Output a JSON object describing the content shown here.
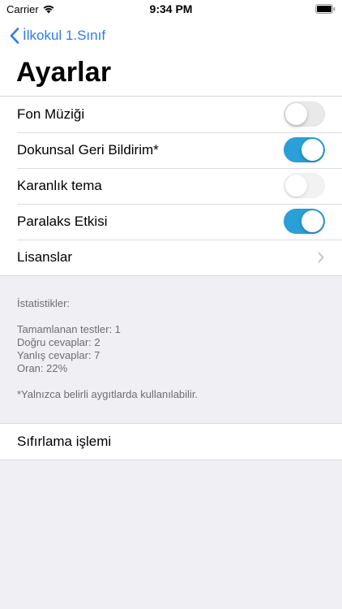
{
  "status_bar": {
    "carrier": "Carrier",
    "time": "9:34 PM"
  },
  "nav": {
    "back_label": "İlkokul 1.Sınıf",
    "title": "Ayarlar"
  },
  "settings": {
    "items": [
      {
        "label": "Fon Müziği",
        "control": "toggle",
        "on": false
      },
      {
        "label": "Dokunsal Geri Bildirim*",
        "control": "toggle",
        "on": true
      },
      {
        "label": "Karanlık tema",
        "control": "toggle",
        "on": false,
        "disabled": true
      },
      {
        "label": "Paralaks Etkisi",
        "control": "toggle",
        "on": true
      },
      {
        "label": "Lisanslar",
        "control": "disclosure"
      }
    ]
  },
  "stats": {
    "heading": "İstatistikler:",
    "completed_tests": "Tamamlanan testler: 1",
    "correct_answers": "Doğru cevaplar: 2",
    "wrong_answers": "Yanlış cevaplar: 7",
    "ratio": "Oran: 22%",
    "footnote": "*Yalnızca belirli aygıtlarda kullanılabilir."
  },
  "reset": {
    "label": "Sıfırlama işlemi"
  },
  "colors": {
    "accent": "#2f7bf5",
    "toggle_on": "#2a9fd8",
    "background": "#efeff4"
  }
}
